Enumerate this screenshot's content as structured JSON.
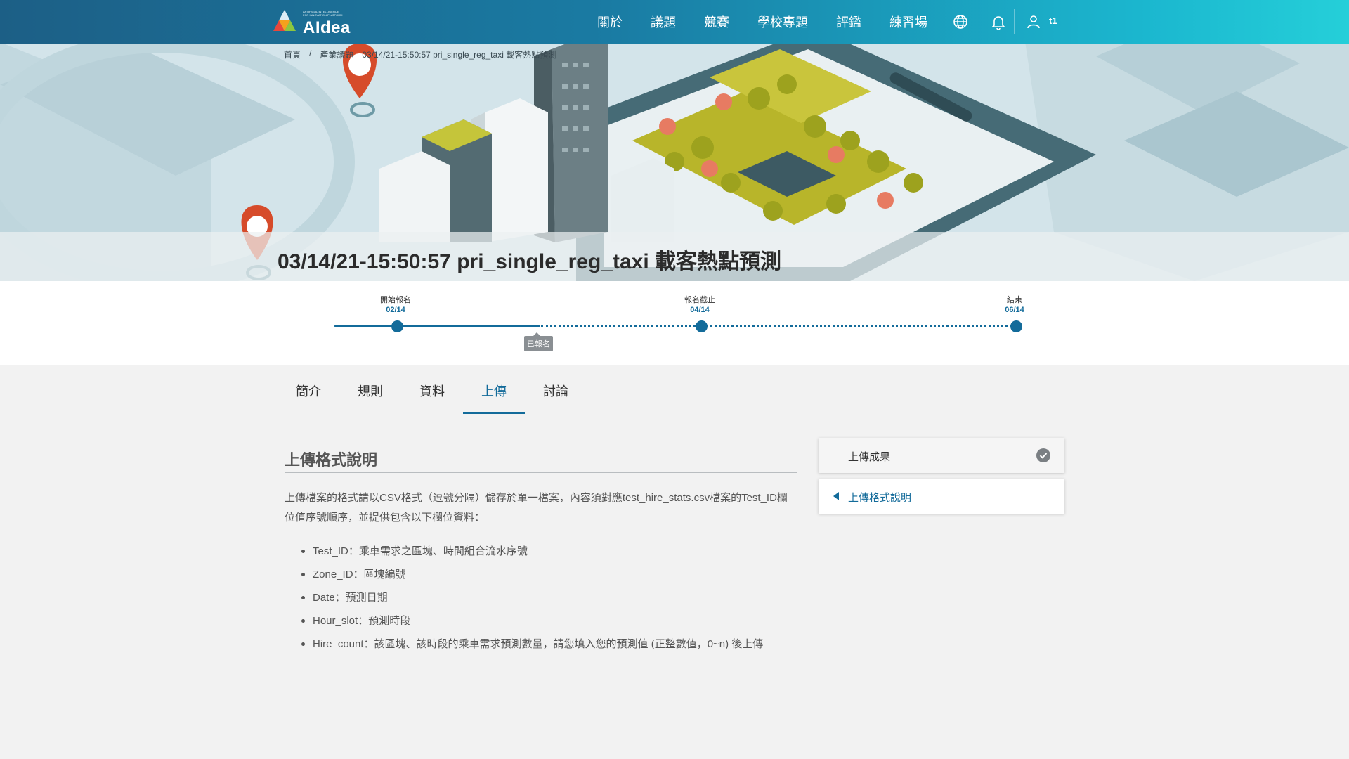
{
  "brand": {
    "name": "AIdea",
    "tagline": "ARTIFICIAL INTELLIGENCE FOR INNOVATION PLATFORM"
  },
  "nav": {
    "items": [
      "關於",
      "議題",
      "競賽",
      "學校專題",
      "評鑑",
      "練習場"
    ],
    "icons": [
      "globe-icon",
      "bell-icon",
      "user-icon"
    ],
    "user": "t1"
  },
  "breadcrumb": [
    "首頁",
    "/",
    "產業議題",
    "03/14/21-15:50:57 pri_single_reg_taxi 載客熱點預測"
  ],
  "title": "03/14/21-15:50:57 pri_single_reg_taxi 載客熱點預測",
  "timeline": {
    "milestones": [
      {
        "label": "開始報名",
        "date": "02/14"
      },
      {
        "label": "報名截止",
        "date": "04/14"
      },
      {
        "label": "結束",
        "date": "06/14"
      }
    ],
    "status_badge": "已報名"
  },
  "tabs": [
    "簡介",
    "規則",
    "資料",
    "上傳",
    "討論"
  ],
  "active_tab": "上傳",
  "content": {
    "heading": "上傳格式說明",
    "paragraph": "上傳檔案的格式請以CSV格式（逗號分隔）儲存於單一檔案，內容須對應test_hire_stats.csv檔案的Test_ID欄位值序號順序，並提供包含以下欄位資料：",
    "bullets": [
      "Test_ID：乘車需求之區塊、時間組合流水序號",
      "Zone_ID：區塊編號",
      "Date：預測日期",
      "Hour_slot：預測時段",
      "Hire_count：該區塊、該時段的乘車需求預測數量，請您填入您的預測值 (正整數值，0~n) 後上傳"
    ]
  },
  "side_panel": {
    "items": [
      "上傳成果",
      "上傳格式說明"
    ]
  },
  "colors": {
    "accent": "#136b9a",
    "nav_start": "#1c5f86",
    "nav_end": "#25cfd9"
  }
}
